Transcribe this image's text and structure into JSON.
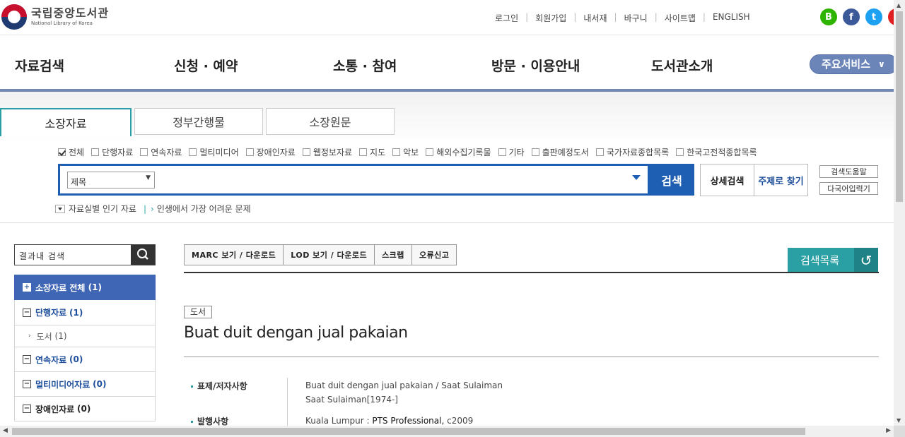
{
  "header": {
    "logo_kr": "국립중앙도서관",
    "logo_en": "National Library of Korea",
    "util": [
      "로그인",
      "회원가입",
      "내서재",
      "바구니",
      "사이트맵",
      "ENGLISH"
    ],
    "social_b": "B",
    "social_f": "f",
    "social_t": "t"
  },
  "nav": {
    "items": [
      "자료검색",
      "신청 · 예약",
      "소통 · 참여",
      "방문 · 이용안내",
      "도서관소개"
    ],
    "main_service": "주요서비스"
  },
  "search": {
    "tabs": [
      "소장자료",
      "정부간행물",
      "소장원문"
    ],
    "filters": [
      {
        "label": "전체",
        "checked": true
      },
      {
        "label": "단행자료",
        "checked": false
      },
      {
        "label": "연속자료",
        "checked": false
      },
      {
        "label": "멀티미디어",
        "checked": false
      },
      {
        "label": "장애인자료",
        "checked": false
      },
      {
        "label": "웹정보자료",
        "checked": false
      },
      {
        "label": "지도",
        "checked": false
      },
      {
        "label": "악보",
        "checked": false
      },
      {
        "label": "해외수집기록물",
        "checked": false
      },
      {
        "label": "기타",
        "checked": false
      },
      {
        "label": "출판예정도서",
        "checked": false
      },
      {
        "label": "국가자료종합목록",
        "checked": false
      },
      {
        "label": "한국고전적종합목록",
        "checked": false
      }
    ],
    "field_select": "제목",
    "search_button": "검색",
    "detail_search": "상세검색",
    "subject_search": "주제로 찾기",
    "search_help": "검색도움말",
    "multilang_input": "다국어입력기",
    "popular_label": "자료실별 인기 자료",
    "popular_link": "인생에서 가장 어려운 문제"
  },
  "sidebar": {
    "in_result_label": "결과내 검색",
    "facets": {
      "all": {
        "label": "소장자료 전체",
        "count": "(1)"
      },
      "mono": {
        "label": "단행자료",
        "count": "(1)"
      },
      "book": {
        "label": "도서",
        "count": "(1)"
      },
      "serial": {
        "label": "연속자료",
        "count": "(0)"
      },
      "multimedia": {
        "label": "멀티미디어자료",
        "count": "(0)"
      },
      "disabled": {
        "label": "장애인자료",
        "count": "(0)"
      }
    }
  },
  "result": {
    "actions": [
      "MARC 보기 / 다운로드",
      "LOD 보기 / 다운로드",
      "스크랩",
      "오류신고"
    ],
    "list_button": "검색목록",
    "type_tag": "도서",
    "title": "Buat duit dengan jual pakaian",
    "fields": {
      "title_author_label": "표제/저자사항",
      "title_author_value1": "Buat duit dengan jual pakaian / Saat Sulaiman",
      "title_author_value2": "Saat Sulaiman[1974-]",
      "publication_label": "발행사항",
      "publication_place": "Kuala Lumpur :",
      "publication_publisher": "PTS Professional,",
      "publication_year": "c2009"
    }
  }
}
